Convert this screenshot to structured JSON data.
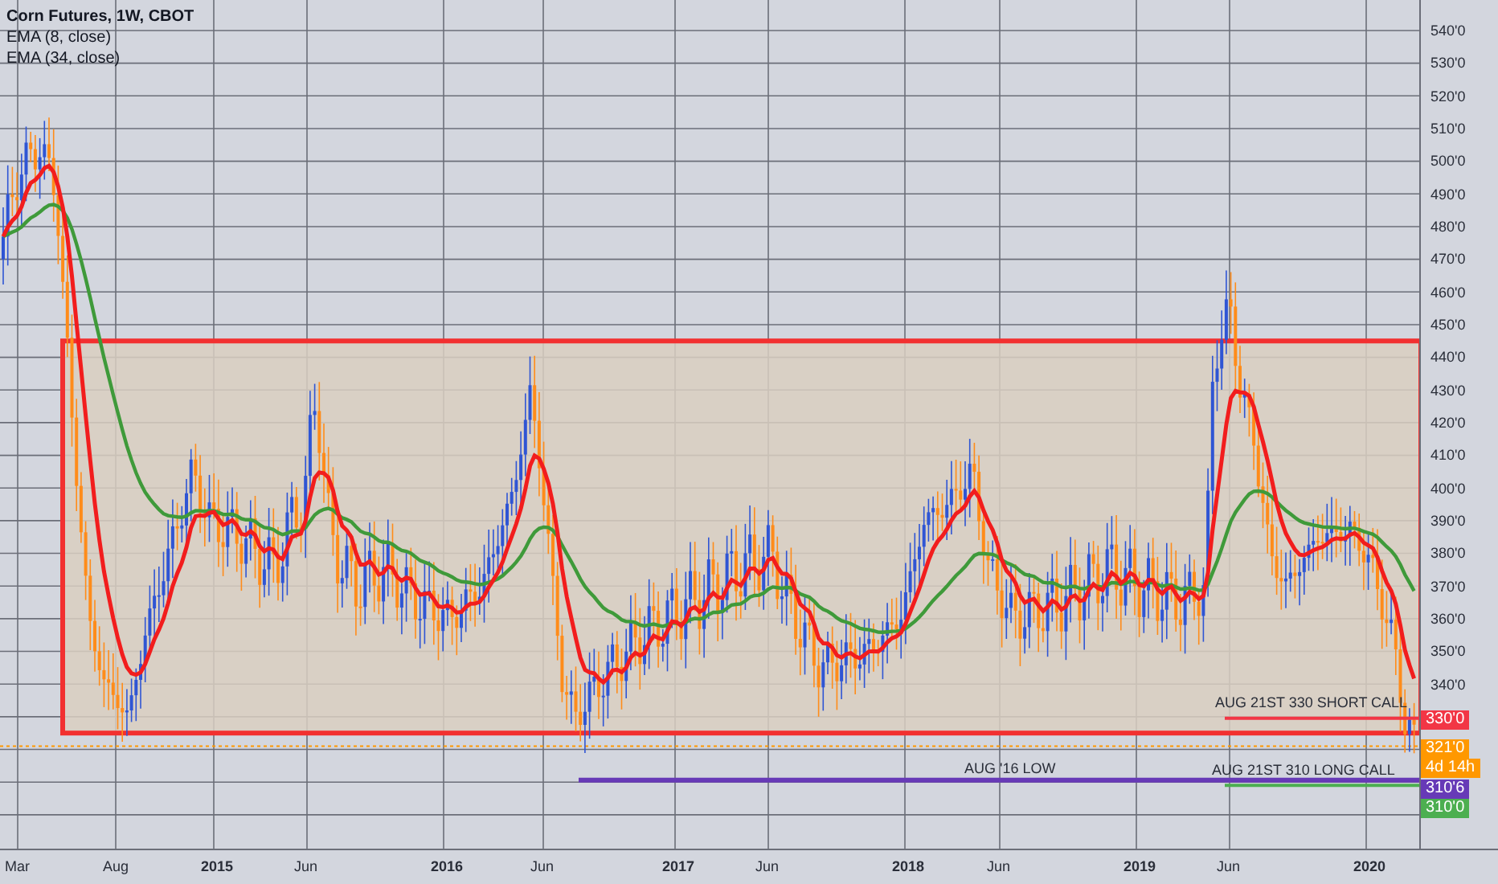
{
  "legend": {
    "title": "Corn Futures, 1W, CBOT",
    "indicators": [
      {
        "label": "EMA (8, close)"
      },
      {
        "label": "EMA (34, close)"
      }
    ]
  },
  "annotations": [
    {
      "kind": "low",
      "text": "AUG '16 LOW"
    },
    {
      "kind": "short",
      "text": "AUG 21ST 330 SHORT CALL"
    },
    {
      "kind": "long",
      "text": "AUG 21ST 310 LONG CALL"
    }
  ],
  "price_axis": {
    "labels": [
      "540'0",
      "530'0",
      "520'0",
      "510'0",
      "500'0",
      "490'0",
      "480'0",
      "470'0",
      "460'0",
      "450'0",
      "440'0",
      "430'0",
      "420'0",
      "410'0",
      "400'0",
      "390'0",
      "380'0",
      "370'0",
      "360'0",
      "350'0",
      "340'0"
    ],
    "tags": [
      {
        "text": "330'0",
        "color": "#f23645"
      },
      {
        "text": "321'0",
        "color": "#ff9800"
      },
      {
        "text": "4d 14h",
        "color": "#ff9800"
      },
      {
        "text": "310'6",
        "color": "#673ab7"
      },
      {
        "text": "310'0",
        "color": "#4caf50"
      }
    ]
  },
  "time_axis": {
    "labels": [
      {
        "text": "Mar",
        "bold": false
      },
      {
        "text": "Aug",
        "bold": false
      },
      {
        "text": "2015",
        "bold": true
      },
      {
        "text": "Jun",
        "bold": false
      },
      {
        "text": "2016",
        "bold": true
      },
      {
        "text": "Jun",
        "bold": false
      },
      {
        "text": "2017",
        "bold": true
      },
      {
        "text": "Jun",
        "bold": false
      },
      {
        "text": "2018",
        "bold": true
      },
      {
        "text": "Jun",
        "bold": false
      },
      {
        "text": "2019",
        "bold": true
      },
      {
        "text": "Jun",
        "bold": false
      },
      {
        "text": "2020",
        "bold": true
      }
    ]
  }
}
